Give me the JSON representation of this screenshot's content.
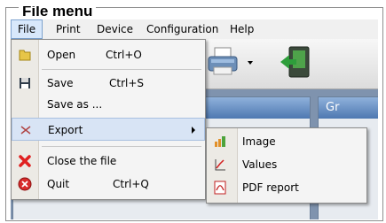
{
  "frame": {
    "title": "File menu"
  },
  "menubar": {
    "items": [
      {
        "label": "File",
        "name": "menu-file"
      },
      {
        "label": "Print",
        "name": "menu-print"
      },
      {
        "label": "Device",
        "name": "menu-device"
      },
      {
        "label": "Configuration",
        "name": "menu-configuration"
      },
      {
        "label": "Help",
        "name": "menu-help"
      }
    ]
  },
  "file_menu": {
    "open": {
      "label": "Open",
      "shortcut": "Ctrl+O",
      "icon": "folder-icon"
    },
    "save": {
      "label": "Save",
      "shortcut": "Ctrl+S",
      "icon": "floppy-disk-icon"
    },
    "save_as": {
      "label": "Save as ..."
    },
    "export": {
      "label": "Export",
      "icon": "export-icon"
    },
    "close": {
      "label": "Close the file",
      "icon": "red-x-icon"
    },
    "quit": {
      "label": "Quit",
      "shortcut": "Ctrl+Q",
      "icon": "quit-icon"
    }
  },
  "export_submenu": {
    "image": {
      "label": "Image",
      "icon": "bar-chart-icon"
    },
    "values": {
      "label": "Values",
      "icon": "values-chart-icon"
    },
    "pdf": {
      "label": "PDF report",
      "icon": "pdf-icon"
    }
  },
  "panels": {
    "right_tab_label": "Gr"
  },
  "colors": {
    "menu_highlight": "#d8e4f5",
    "panel_header": "#4e78b1"
  }
}
